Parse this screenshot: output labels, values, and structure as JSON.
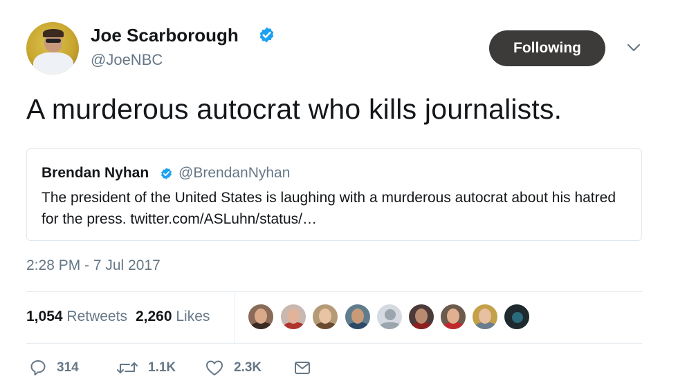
{
  "author": {
    "name": "Joe Scarborough",
    "handle": "@JoeNBC",
    "verified": true
  },
  "follow_button": {
    "label": "Following"
  },
  "tweet": {
    "text": "A murderous autocrat who kills journalists."
  },
  "quoted_tweet": {
    "name": "Brendan Nyhan",
    "handle": "@BrendanNyhan",
    "verified": true,
    "text": "The president of the United States is laughing with a murderous autocrat about his hatred for the press. twitter.com/ASLuhn/status/…"
  },
  "timestamp": "2:28 PM - 7 Jul 2017",
  "stats": {
    "retweets_count": "1,054",
    "retweets_label": "Retweets",
    "likes_count": "2,260",
    "likes_label": "Likes"
  },
  "actions": {
    "replies": "314",
    "retweets": "1.1K",
    "likes": "2.3K"
  },
  "icons": {
    "verified": "verified-badge-icon",
    "caret": "chevron-down-icon",
    "reply": "reply-icon",
    "retweet": "retweet-icon",
    "like": "heart-icon",
    "dm": "envelope-icon"
  },
  "colors": {
    "verified": "#1da1f2",
    "secondary_text": "#657786",
    "follow_button_bg": "#3d3b3a"
  }
}
